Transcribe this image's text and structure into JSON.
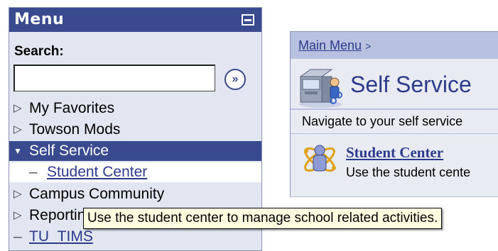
{
  "menu": {
    "title": "Menu",
    "search_label": "Search:",
    "search_value": "",
    "search_go_glyph": "»",
    "items": [
      {
        "label": "My Favorites",
        "arrow": "▷"
      },
      {
        "label": "Towson Mods",
        "arrow": "▷"
      },
      {
        "label": "Self Service",
        "arrow": "▼",
        "selected": true
      },
      {
        "label": "Student Center",
        "child": true,
        "dash": "–"
      },
      {
        "label": "Campus Community",
        "arrow": "▷"
      },
      {
        "label": "Reporting Tools",
        "arrow": "▷"
      },
      {
        "label": "TU_TIMS",
        "dash": "–"
      }
    ]
  },
  "content": {
    "breadcrumb_link": "Main Menu",
    "breadcrumb_sep": ">",
    "title": "Self Service",
    "description": "Navigate to your self service",
    "card": {
      "link": "Student Center",
      "description": "Use the student cente"
    }
  },
  "tooltip": {
    "text": "Use the student center to manage school related activities."
  },
  "colors": {
    "header_bg": "#3a4a8f",
    "panel_bg": "#e2e6f1",
    "link": "#2c3a8c",
    "tooltip_bg": "#ffffe1"
  }
}
